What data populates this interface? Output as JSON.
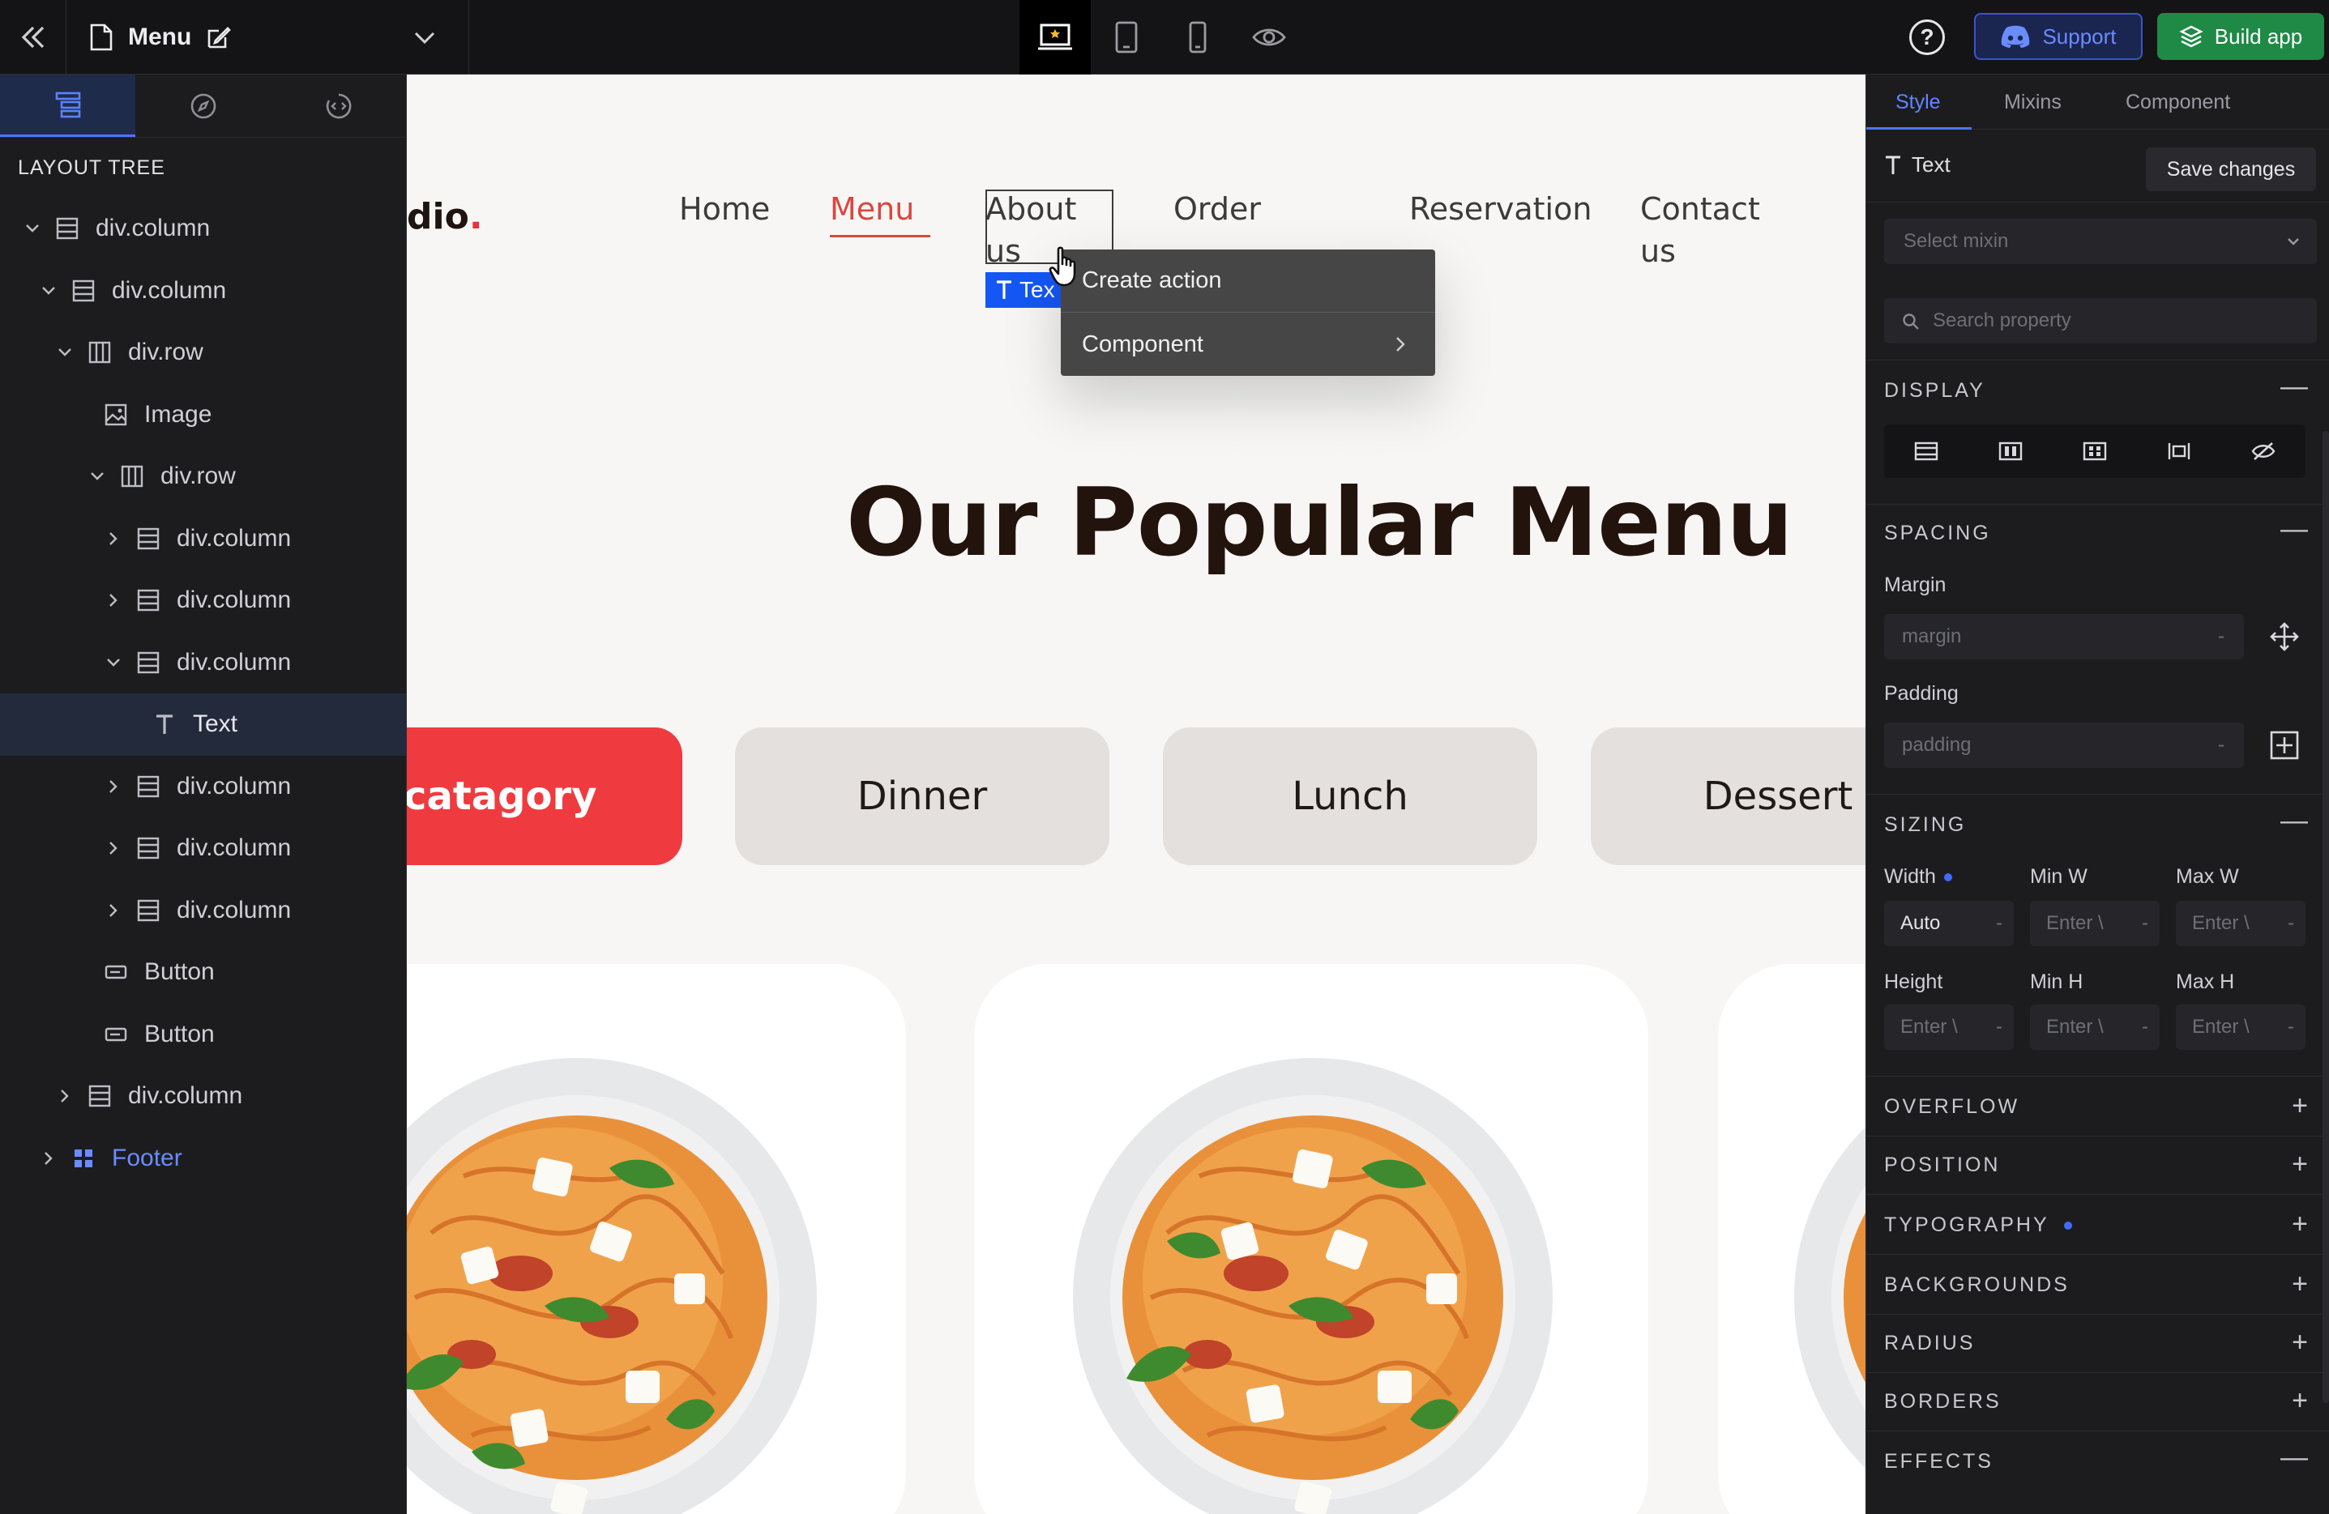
{
  "topbar": {
    "page_name": "Menu",
    "support_label": "Support",
    "build_label": "Build app",
    "help_label": "?"
  },
  "left_panel": {
    "section_title": "LAYOUT TREE",
    "tree": [
      {
        "label": "div.column",
        "icon": "column-icon",
        "expanded": true
      },
      {
        "label": "div.column",
        "icon": "column-icon",
        "expanded": true
      },
      {
        "label": "div.row",
        "icon": "row-icon",
        "expanded": true
      },
      {
        "label": "Image",
        "icon": "image-icon"
      },
      {
        "label": "div.row",
        "icon": "row-icon",
        "expanded": true
      },
      {
        "label": "div.column",
        "icon": "column-icon",
        "expanded": false
      },
      {
        "label": "div.column",
        "icon": "column-icon",
        "expanded": false
      },
      {
        "label": "div.column",
        "icon": "column-icon",
        "expanded": true
      },
      {
        "label": "Text",
        "icon": "text-icon",
        "selected": true
      },
      {
        "label": "div.column",
        "icon": "column-icon",
        "expanded": false
      },
      {
        "label": "div.column",
        "icon": "column-icon",
        "expanded": false
      },
      {
        "label": "div.column",
        "icon": "column-icon",
        "expanded": false
      },
      {
        "label": "Button",
        "icon": "button-icon"
      },
      {
        "label": "Button",
        "icon": "button-icon"
      },
      {
        "label": "div.column",
        "icon": "column-icon",
        "expanded": false
      },
      {
        "label": "Footer",
        "icon": "component-icon",
        "expanded": false
      }
    ]
  },
  "canvas": {
    "logo_text": "dio",
    "logo_dot": ".",
    "nav": {
      "home": "Home",
      "menu": "Menu",
      "about_line1": "About",
      "about_line2": "us",
      "order": "Order",
      "reservation": "Reservation",
      "contact_line1": "Contact",
      "contact_line2": "us"
    },
    "selection_label": "Tex",
    "context_menu": {
      "create_action": "Create action",
      "component": "Component"
    },
    "heading": "Our Popular Menu",
    "categories": [
      "catagory",
      "Dinner",
      "Lunch",
      "Dessert"
    ],
    "accent_color": "#ef3b3f"
  },
  "right_panel": {
    "tabs": {
      "style": "Style",
      "mixins": "Mixins",
      "component": "Component"
    },
    "element_name": "Text",
    "save_label": "Save changes",
    "mixin_placeholder": "Select mixin",
    "search_placeholder": "Search property",
    "sections": {
      "display": "DISPLAY",
      "spacing": "SPACING",
      "sizing": "SIZING",
      "overflow": "OVERFLOW",
      "position": "POSITION",
      "typography": "TYPOGRAPHY",
      "backgrounds": "BACKGROUNDS",
      "radius": "RADIUS",
      "borders": "BORDERS",
      "effects": "EFFECTS"
    },
    "margin_label": "Margin",
    "margin_placeholder": "margin",
    "padding_label": "Padding",
    "padding_placeholder": "padding",
    "sizing": {
      "width": "Width",
      "min_w": "Min W",
      "max_w": "Max W",
      "height": "Height",
      "min_h": "Min H",
      "max_h": "Max H",
      "width_value": "Auto",
      "enter_placeholder": "Enter \\"
    }
  }
}
